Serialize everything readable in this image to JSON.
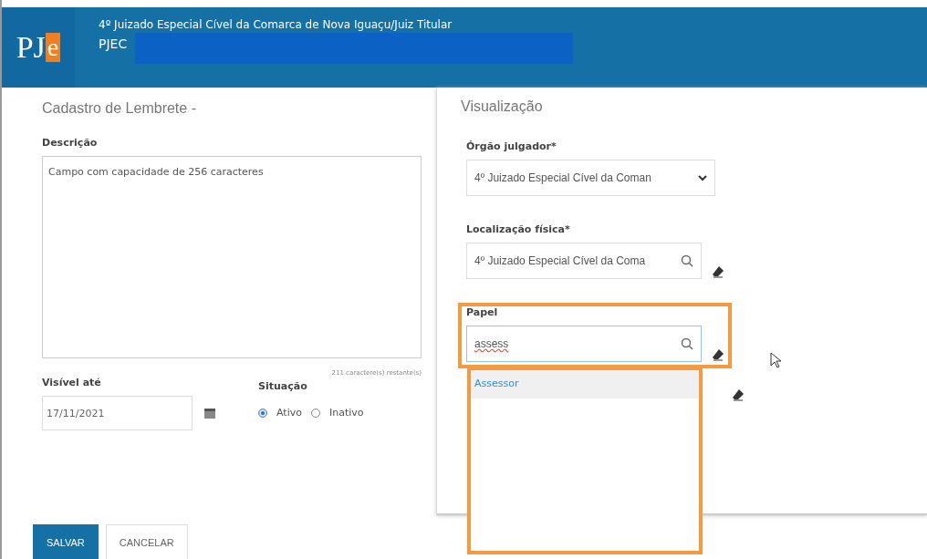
{
  "header": {
    "logo_main": "PJ",
    "logo_accent": "e",
    "title": "4º Juizado Especial Cível da Comarca de Nova Iguaçu/Juiz Titular",
    "subtitle": "PJEC"
  },
  "form": {
    "title": "Cadastro de Lembrete -",
    "description_label": "Descrição",
    "description_value": "Campo com capacidade de 256 caracteres",
    "counter": "211 caractere(s) restante(s)",
    "date_label": "Visível até",
    "date_value": "17/11/2021",
    "status_label": "Situação",
    "status_options": [
      {
        "label": "Ativo",
        "selected": true
      },
      {
        "label": "Inativo",
        "selected": false
      }
    ]
  },
  "preview": {
    "title": "Visualização",
    "fields": [
      {
        "kind": "select",
        "label": "Órgão julgador*",
        "value": "4º Juizado Especial Cível da Coman"
      },
      {
        "kind": "search",
        "label": "Localização física*",
        "value": "4º Juizado Especial Cível da Coma"
      },
      {
        "kind": "search",
        "label": "Papel",
        "value": "assess",
        "focused": true
      }
    ],
    "suggestions": [
      {
        "label": "Assessor",
        "selected": true
      }
    ]
  },
  "buttons": [
    {
      "label": "SALVAR",
      "kind": "primary"
    },
    {
      "label": "CANCELAR",
      "kind": "secondary"
    }
  ]
}
